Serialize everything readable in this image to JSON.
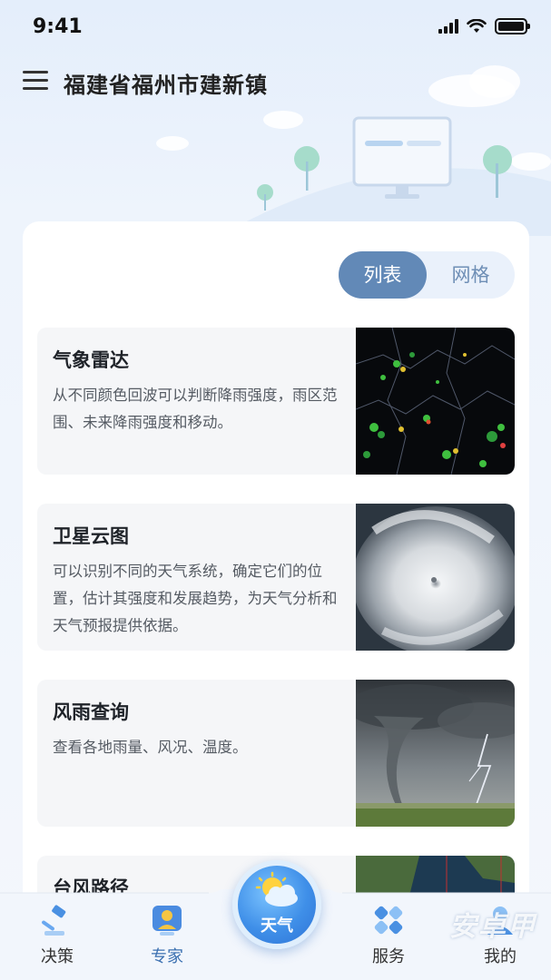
{
  "status_bar": {
    "time": "9:41"
  },
  "header": {
    "location": "福建省福州市建新镇"
  },
  "view_toggle": {
    "list_label": "列表",
    "grid_label": "网格",
    "selected": "列表"
  },
  "items": [
    {
      "title": "气象雷达",
      "description": "从不同颜色回波可以判断降雨强度，雨区范围、未来降雨强度和移动。"
    },
    {
      "title": "卫星云图",
      "description": "可以识别不同的天气系统，确定它们的位置，估计其强度和发展趋势，为天气分析和天气预报提供依据。"
    },
    {
      "title": "风雨查询",
      "description": "查看各地雨量、风况、温度。"
    },
    {
      "title": "台风路径",
      "description": ""
    }
  ],
  "bottom_nav": {
    "items": [
      {
        "label": "决策",
        "icon": "gavel-icon"
      },
      {
        "label": "专家",
        "icon": "expert-icon"
      },
      {
        "label": "服务",
        "icon": "service-icon"
      },
      {
        "label": "我的",
        "icon": "user-icon"
      }
    ],
    "center": {
      "label": "天气",
      "icon": "sun-cloud-icon"
    },
    "active": "专家"
  },
  "watermark": "安卓甲",
  "colors": {
    "accent": "#6289b7",
    "active_nav": "#3a6fb0",
    "card_bg": "#f5f6f8"
  }
}
